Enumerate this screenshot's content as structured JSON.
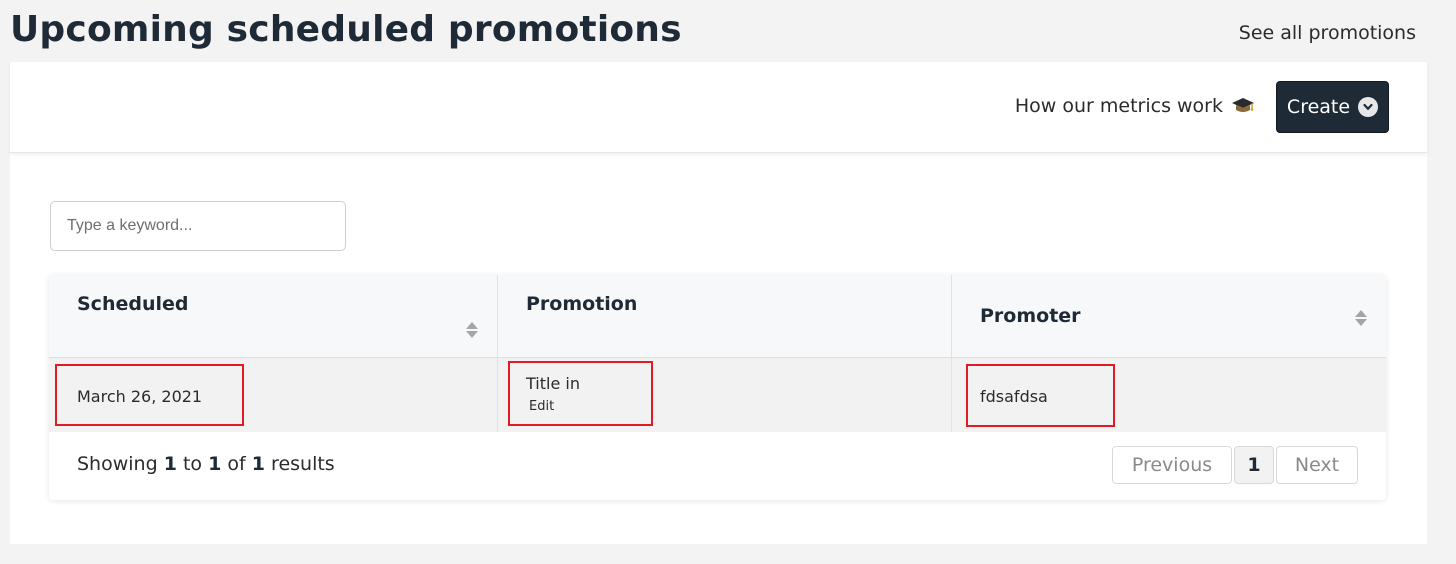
{
  "page": {
    "title": "Upcoming scheduled promotions",
    "see_all_label": "See all promotions"
  },
  "toolbar": {
    "metrics_label": "How our metrics work",
    "metrics_icon": "graduation-cap-icon",
    "create_label": "Create",
    "create_icon": "chevron-down-icon"
  },
  "search": {
    "placeholder": "Type a keyword...",
    "value": ""
  },
  "table": {
    "columns": [
      {
        "label": "Scheduled",
        "sortable": true
      },
      {
        "label": "Promotion",
        "sortable": false
      },
      {
        "label": "Promoter",
        "sortable": true
      }
    ],
    "rows": [
      {
        "scheduled": "March 26, 2021",
        "promotion_title": "Title in",
        "promotion_action": "Edit",
        "promoter": "fdsafdsa"
      }
    ],
    "highlight_color": "#e01b24"
  },
  "footer": {
    "showing_prefix": "Showing",
    "from": "1",
    "to_word": "to",
    "to": "1",
    "of_word": "of",
    "total": "1",
    "results_word": "results",
    "prev_label": "Previous",
    "current_page": "1",
    "next_label": "Next"
  },
  "colors": {
    "primary_dark": "#1e2a36",
    "background": "#f3f3f3",
    "card": "#ffffff"
  }
}
